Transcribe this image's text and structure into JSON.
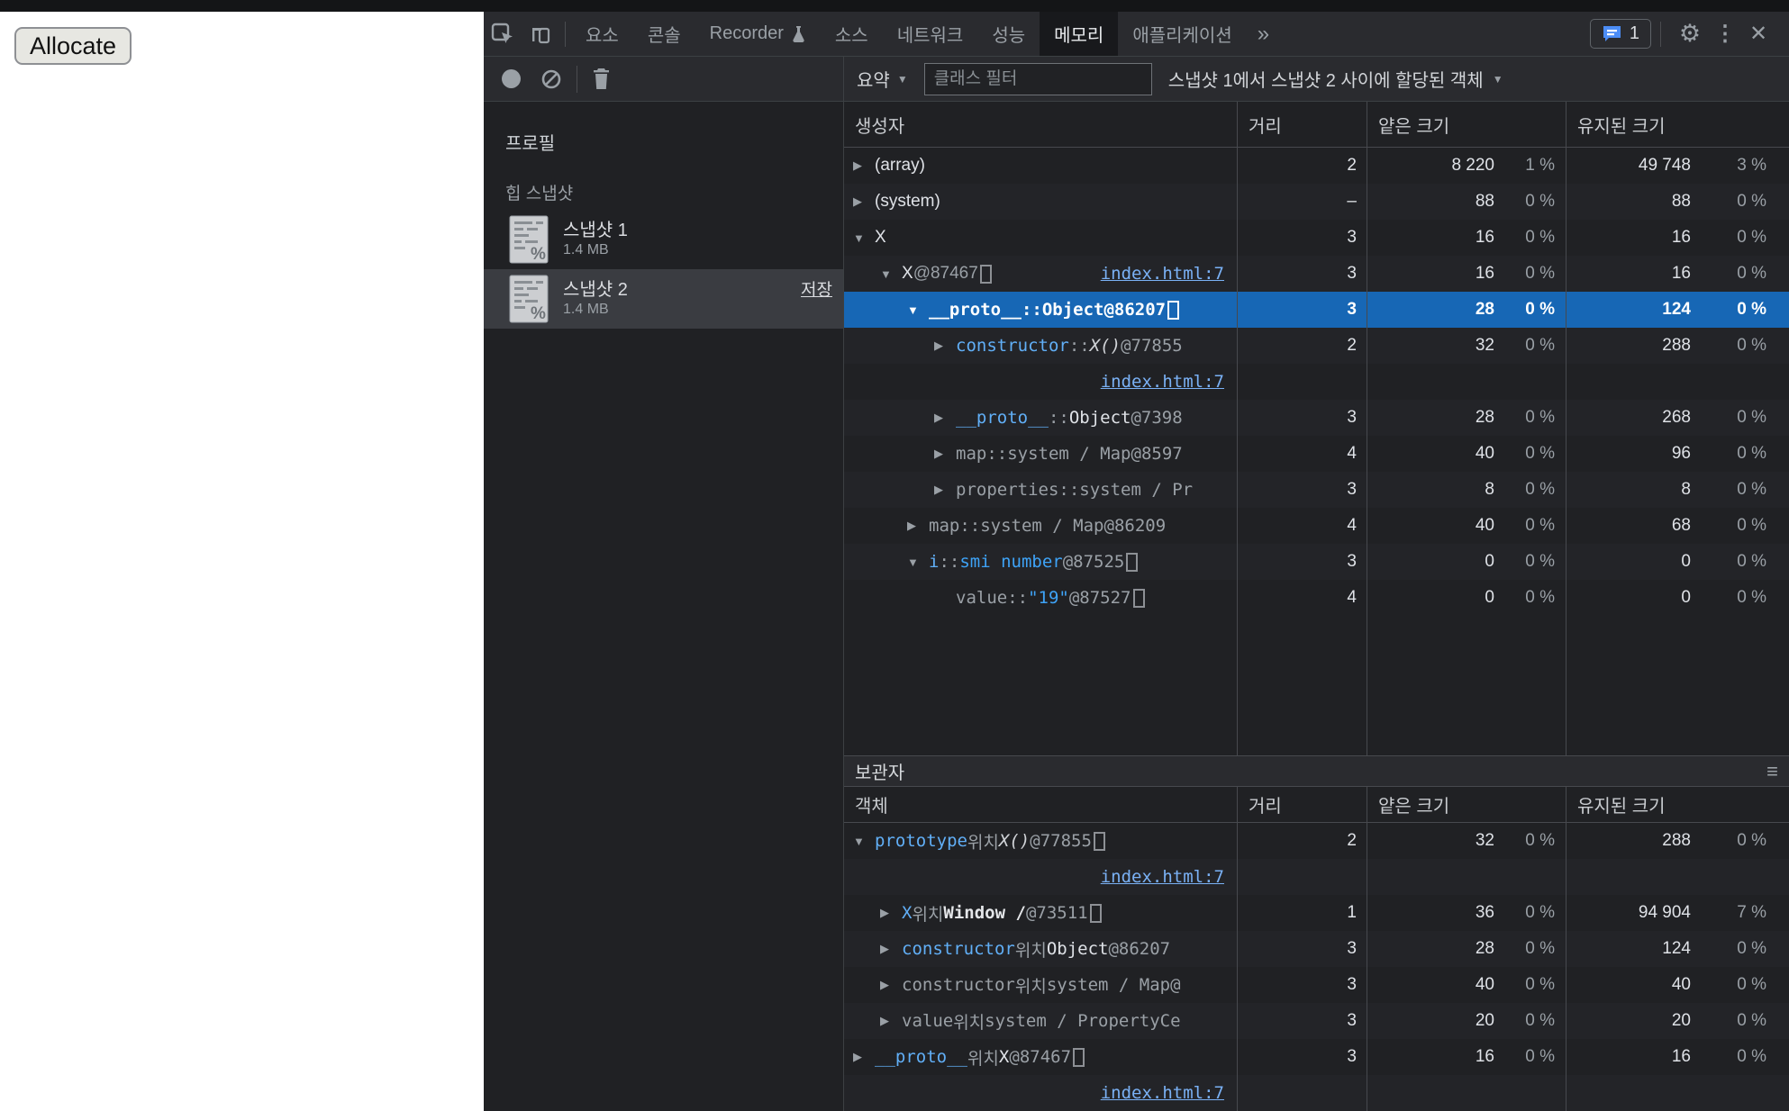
{
  "page": {
    "allocate_button": "Allocate"
  },
  "colors": {
    "accent_selection": "#1767b5",
    "link_blue": "#7ab1f5",
    "name_blue": "#61aff7",
    "background": "#202124"
  },
  "icons": {
    "caret_down": "▼",
    "twisty_open": "▼",
    "twisty_closed": "▶",
    "overflow": "»",
    "gear": "⚙",
    "kebab": "⋮",
    "close": "✕",
    "menu": "≡"
  },
  "devtools": {
    "tabs": {
      "items": [
        {
          "label": "요소"
        },
        {
          "label": "콘솔"
        },
        {
          "label": "Recorder",
          "flask": true
        },
        {
          "label": "소스"
        },
        {
          "label": "네트워크"
        },
        {
          "label": "성능"
        },
        {
          "label": "메모리",
          "active": true
        },
        {
          "label": "애플리케이션"
        }
      ],
      "issues_count": "1"
    },
    "toolbar": {
      "summary_label": "요약",
      "filter_placeholder": "클래스 필터",
      "allocation_label": "스냅샷 1에서 스냅샷 2 사이에 할당된 객체"
    },
    "sidebar": {
      "profiles_label": "프로필",
      "heap_section_label": "힙 스냅샷",
      "snapshots": [
        {
          "name": "스냅샷 1",
          "size": "1.4 MB",
          "selected": false
        },
        {
          "name": "스냅샷 2",
          "size": "1.4 MB",
          "selected": true,
          "save_label": "저장"
        }
      ]
    },
    "constructor_table": {
      "headers": {
        "constructor": "생성자",
        "distance": "거리",
        "shallow": "얕은 크기",
        "retained": "유지된 크기"
      },
      "rows": [
        {
          "mono": false,
          "ind": 0,
          "tw": "c",
          "parts": [
            [
              "plain",
              "(array)"
            ]
          ],
          "d": "2",
          "sh": "8 220",
          "shp": "1 %",
          "re": "49 748",
          "rep": "3 %"
        },
        {
          "mono": false,
          "ind": 0,
          "tw": "c",
          "parts": [
            [
              "plain",
              "(system)"
            ]
          ],
          "d": "–",
          "sh": "88",
          "shp": "0 %",
          "re": "88",
          "rep": "0 %"
        },
        {
          "mono": false,
          "ind": 0,
          "tw": "o",
          "parts": [
            [
              "plain",
              "X"
            ]
          ],
          "d": "3",
          "sh": "16",
          "shp": "0 %",
          "re": "16",
          "rep": "0 %"
        },
        {
          "mono": false,
          "ind": 1,
          "tw": "o",
          "parts": [
            [
              "plain",
              "X "
            ],
            [
              "dim",
              "@87467 "
            ],
            [
              "box",
              ""
            ]
          ],
          "ilink": "index.html:7",
          "d": "3",
          "sh": "16",
          "shp": "0 %",
          "re": "16",
          "rep": "0 %"
        },
        {
          "mono": true,
          "sel": true,
          "ind": 2,
          "tw": "o",
          "parts": [
            [
              "name",
              "__proto__"
            ],
            [
              "dim",
              " :: "
            ],
            [
              "plain",
              "Object"
            ],
            [
              "dim",
              " @86207 "
            ],
            [
              "box",
              ""
            ]
          ],
          "d": "3",
          "sh": "28",
          "shp": "0 %",
          "re": "124",
          "rep": "0 %"
        },
        {
          "mono": true,
          "ind": 3,
          "tw": "c",
          "parts": [
            [
              "name",
              "constructor"
            ],
            [
              "dim",
              " :: "
            ],
            [
              "italic",
              "X()"
            ],
            [
              "dim",
              " @77855"
            ]
          ],
          "d": "2",
          "sh": "32",
          "shp": "0 %",
          "re": "288",
          "rep": "0 %"
        },
        {
          "linkrow": true,
          "link": "index.html:7"
        },
        {
          "mono": true,
          "ind": 3,
          "tw": "c",
          "parts": [
            [
              "name",
              "__proto__"
            ],
            [
              "dim",
              " :: "
            ],
            [
              "plain",
              "Object"
            ],
            [
              "dim",
              " @7398"
            ]
          ],
          "d": "3",
          "sh": "28",
          "shp": "0 %",
          "re": "268",
          "rep": "0 %"
        },
        {
          "mono": true,
          "ind": 3,
          "tw": "c",
          "parts": [
            [
              "gray",
              "map"
            ],
            [
              "dim",
              " :: "
            ],
            [
              "gray",
              "system / Map"
            ],
            [
              "dim",
              " @8597"
            ]
          ],
          "d": "4",
          "sh": "40",
          "shp": "0 %",
          "re": "96",
          "rep": "0 %"
        },
        {
          "mono": true,
          "ind": 3,
          "tw": "c",
          "parts": [
            [
              "gray",
              "properties"
            ],
            [
              "dim",
              " :: "
            ],
            [
              "gray",
              "system / Pr"
            ]
          ],
          "d": "3",
          "sh": "8",
          "shp": "0 %",
          "re": "8",
          "rep": "0 %"
        },
        {
          "mono": true,
          "ind": 2,
          "tw": "c",
          "parts": [
            [
              "gray",
              "map"
            ],
            [
              "dim",
              " :: "
            ],
            [
              "gray",
              "system / Map"
            ],
            [
              "dim",
              " @86209"
            ]
          ],
          "d": "4",
          "sh": "40",
          "shp": "0 %",
          "re": "68",
          "rep": "0 %"
        },
        {
          "mono": true,
          "ind": 2,
          "tw": "o",
          "parts": [
            [
              "name",
              "i"
            ],
            [
              "dim",
              " :: "
            ],
            [
              "val",
              "smi number"
            ],
            [
              "dim",
              " @87525 "
            ],
            [
              "box",
              ""
            ]
          ],
          "d": "3",
          "sh": "0",
          "shp": "0 %",
          "re": "0",
          "rep": "0 %"
        },
        {
          "mono": true,
          "ind": 3,
          "tw": "n",
          "parts": [
            [
              "gray",
              "value"
            ],
            [
              "dim",
              " :: "
            ],
            [
              "val",
              "\"19\""
            ],
            [
              "dim",
              " @87527 "
            ],
            [
              "box",
              ""
            ]
          ],
          "d": "4",
          "sh": "0",
          "shp": "0 %",
          "re": "0",
          "rep": "0 %"
        }
      ]
    },
    "retainers": {
      "title": "보관자",
      "headers": {
        "object": "객체",
        "distance": "거리",
        "shallow": "얕은 크기",
        "retained": "유지된 크기"
      },
      "rows": [
        {
          "mono": true,
          "ind": 0,
          "tw": "o",
          "parts": [
            [
              "name",
              "prototype"
            ],
            [
              "loc",
              " 위치 "
            ],
            [
              "italic",
              "X()"
            ],
            [
              "dim",
              " @77855 "
            ],
            [
              "box",
              ""
            ]
          ],
          "d": "2",
          "sh": "32",
          "shp": "0 %",
          "re": "288",
          "rep": "0 %"
        },
        {
          "linkrow": true,
          "link": "index.html:7"
        },
        {
          "mono": true,
          "ind": 1,
          "tw": "c",
          "parts": [
            [
              "name",
              "X"
            ],
            [
              "loc",
              " 위치 "
            ],
            [
              "bold",
              "Window / "
            ],
            [
              "dim",
              " @73511 "
            ],
            [
              "box",
              ""
            ]
          ],
          "d": "1",
          "sh": "36",
          "shp": "0 %",
          "re": "94 904",
          "rep": "7 %"
        },
        {
          "mono": true,
          "ind": 1,
          "tw": "c",
          "parts": [
            [
              "name",
              "constructor"
            ],
            [
              "loc",
              " 위치 "
            ],
            [
              "plain",
              "Object"
            ],
            [
              "dim",
              " @86207"
            ]
          ],
          "d": "3",
          "sh": "28",
          "shp": "0 %",
          "re": "124",
          "rep": "0 %"
        },
        {
          "mono": true,
          "ind": 1,
          "tw": "c",
          "parts": [
            [
              "gray",
              "constructor"
            ],
            [
              "loc",
              " 위치 "
            ],
            [
              "gray",
              "system / Map"
            ],
            [
              "dim",
              " @"
            ]
          ],
          "d": "3",
          "sh": "40",
          "shp": "0 %",
          "re": "40",
          "rep": "0 %"
        },
        {
          "mono": true,
          "ind": 1,
          "tw": "c",
          "parts": [
            [
              "gray",
              "value"
            ],
            [
              "loc",
              " 위치 "
            ],
            [
              "gray",
              "system / PropertyCe"
            ]
          ],
          "d": "3",
          "sh": "20",
          "shp": "0 %",
          "re": "20",
          "rep": "0 %"
        },
        {
          "mono": true,
          "ind": 0,
          "tw": "c",
          "parts": [
            [
              "name",
              "__proto__"
            ],
            [
              "loc",
              " 위치 "
            ],
            [
              "plain",
              "X"
            ],
            [
              "dim",
              " @87467 "
            ],
            [
              "box",
              ""
            ]
          ],
          "d": "3",
          "sh": "16",
          "shp": "0 %",
          "re": "16",
          "rep": "0 %"
        },
        {
          "linkrow": true,
          "link": "index.html:7"
        }
      ]
    }
  }
}
